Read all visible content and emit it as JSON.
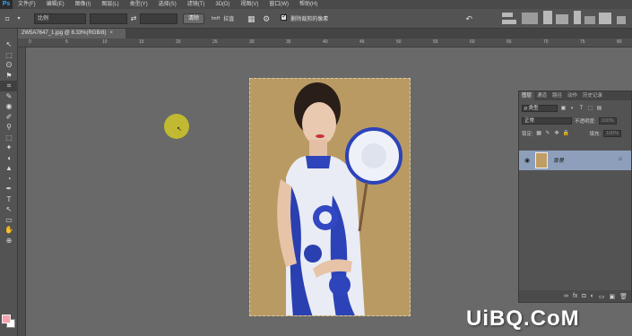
{
  "app": {
    "logo": "Ps"
  },
  "menu": [
    "文件(F)",
    "编辑(E)",
    "图像(I)",
    "图层(L)",
    "类型(Y)",
    "选择(S)",
    "滤镜(T)",
    "3D(D)",
    "视图(V)",
    "窗口(W)",
    "帮助(H)"
  ],
  "options": {
    "ratio_label": "比例",
    "swap_icon": "⇄",
    "clear_button": "清除",
    "straighten_icon": "ImH",
    "straighten_label": "拉直",
    "delete_crop_label": "删除裁剪的像素",
    "delete_crop_checked": true
  },
  "document": {
    "tab_title": "2W5A7647_1.jpg @ 8.33%(RGB/8)",
    "close": "×"
  },
  "ruler_top": [
    "0",
    "5",
    "10",
    "15",
    "20",
    "25",
    "30",
    "35",
    "40",
    "45",
    "50",
    "55",
    "60",
    "65",
    "70",
    "75",
    "80"
  ],
  "tools": [
    "↖",
    "⬚",
    "ʘ",
    "⚑",
    "⌗",
    "✎",
    "◉",
    "✐",
    "⚲",
    "⬚",
    "✦",
    "◖",
    "▲",
    "◔",
    "✒",
    "T",
    "↖",
    "▭",
    "✋",
    "⊕"
  ],
  "colors": {
    "foreground": "#f6a2ac",
    "background": "#ffffff"
  },
  "layers_panel": {
    "tabs": [
      "图层",
      "通道",
      "路径",
      "动作",
      "历史记录"
    ],
    "kind_label": "ρ 类型",
    "blend_mode": "正常",
    "opacity_label": "不透明度:",
    "opacity_value": "100%",
    "lock_label": "锁定:",
    "fill_label": "填充:",
    "fill_value": "100%",
    "layer_name": "背景"
  },
  "watermark": "UiBQ.CoM"
}
